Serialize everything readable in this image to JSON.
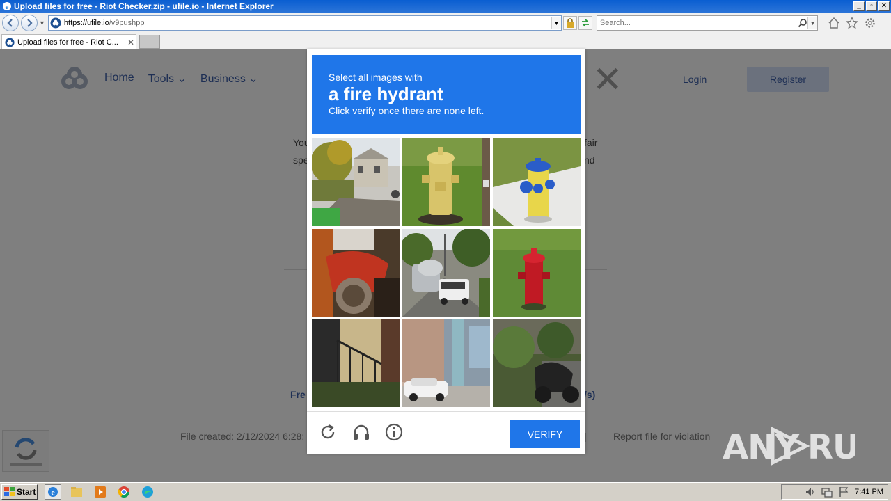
{
  "window": {
    "title": "Upload files for free - Riot Checker.zip - ufile.io - Internet Explorer",
    "controls": [
      "_",
      "▫",
      "✕"
    ]
  },
  "address_bar": {
    "url_host": "https://ufile.io",
    "url_path": "/v9pushpp",
    "search_placeholder": "Search..."
  },
  "tabs": [
    {
      "label": "Upload files for free - Riot C..."
    }
  ],
  "site": {
    "nav": [
      "Home",
      "Tools ⌄",
      "Business ⌄"
    ],
    "login": "Login",
    "register": "Register",
    "card_text_left": [
      "You",
      "spe"
    ],
    "card_text_right": [
      "fair",
      "nd"
    ],
    "free_label": "Fre",
    "speed_label": "/s)",
    "file_meta": "File created: 2/12/2024 6:28:",
    "report_sep": "|",
    "report_link": "Report file for violation"
  },
  "captcha": {
    "prompt_line1": "Select all images with",
    "prompt_target": "a fire hydrant",
    "prompt_line3": "Click verify once there are none left.",
    "verify_label": "VERIFY",
    "tiles": [
      "street-houses",
      "yellow-hydrant",
      "yellow-blue-hydrant",
      "red-motorcycle",
      "truck-street",
      "red-hydrant",
      "building-steps",
      "car-parking-lot",
      "motorcycle-bushes"
    ]
  },
  "watermark": {
    "text": "ANY RUN"
  },
  "taskbar": {
    "start_label": "Start",
    "clock": "7:41 PM"
  },
  "colors": {
    "captcha_blue": "#1f76e9",
    "title_bar": "#0a5ed1",
    "taskbar": "#d4d0c8"
  }
}
